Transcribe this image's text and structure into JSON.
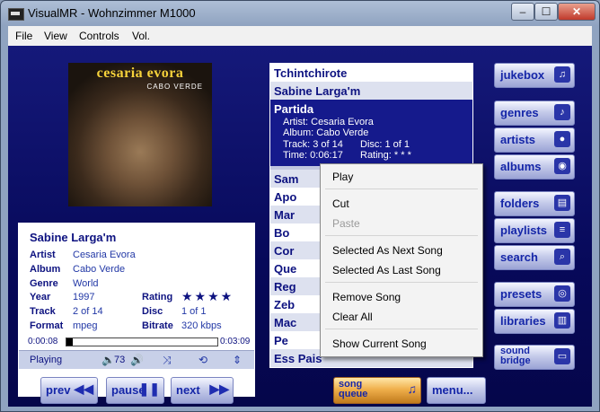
{
  "window": {
    "title": "VisualMR - Wohnzimmer M1000",
    "min": "–",
    "max": "☐",
    "close": "✕"
  },
  "menu": [
    "File",
    "View",
    "Controls",
    "Vol."
  ],
  "album": {
    "title": "cesaria evora",
    "subtitle": "CABO VERDE"
  },
  "now_playing": {
    "title": "Sabine Larga'm",
    "labels": {
      "artist": "Artist",
      "album": "Album",
      "genre": "Genre",
      "year": "Year",
      "track": "Track",
      "format": "Format",
      "rating": "Rating",
      "disc": "Disc",
      "bitrate": "Bitrate"
    },
    "artist": "Cesaria Evora",
    "album": "Cabo Verde",
    "genre": "World",
    "year": "1997",
    "track": "2 of 14",
    "format": "mpeg",
    "rating_stars": 4,
    "disc": "1 of 1",
    "bitrate": "320 kbps",
    "time_elapsed": "0:00:08",
    "time_total": "0:03:09",
    "progress_fraction": 0.04,
    "status": "Playing",
    "volume": "73"
  },
  "playlist": {
    "items": [
      "Tchintchirote",
      "Sabine Larga'm",
      "Partida",
      "Sam",
      "Apo",
      "Mar",
      "Bo",
      "Cor",
      "Que",
      "Reg",
      "Zeb",
      "Mac",
      "Pe",
      "Ess Pais"
    ],
    "selected": {
      "title": "Partida",
      "artist": "Artist: Cesaria Evora",
      "album": "Album: Cabo Verde",
      "track": "Track: 3 of 14",
      "disc": "Disc: 1 of 1",
      "time": "Time: 0:06:17",
      "rating": "Rating: * * *"
    }
  },
  "context_menu": {
    "items": [
      "Play",
      "Cut",
      "Paste",
      "Selected As Next Song",
      "Selected As Last Song",
      "Remove Song",
      "Clear All",
      "Show Current Song"
    ]
  },
  "right_buttons": [
    "jukebox",
    "genres",
    "artists",
    "albums",
    "folders",
    "playlists",
    "search",
    "presets",
    "libraries",
    "sound bridge"
  ],
  "bottom_buttons": [
    "prev",
    "pause",
    "next",
    "song queue",
    "menu..."
  ],
  "colors": {
    "background": "#0a0c66",
    "accent": "#1526a8",
    "selection": "#151a8c"
  }
}
